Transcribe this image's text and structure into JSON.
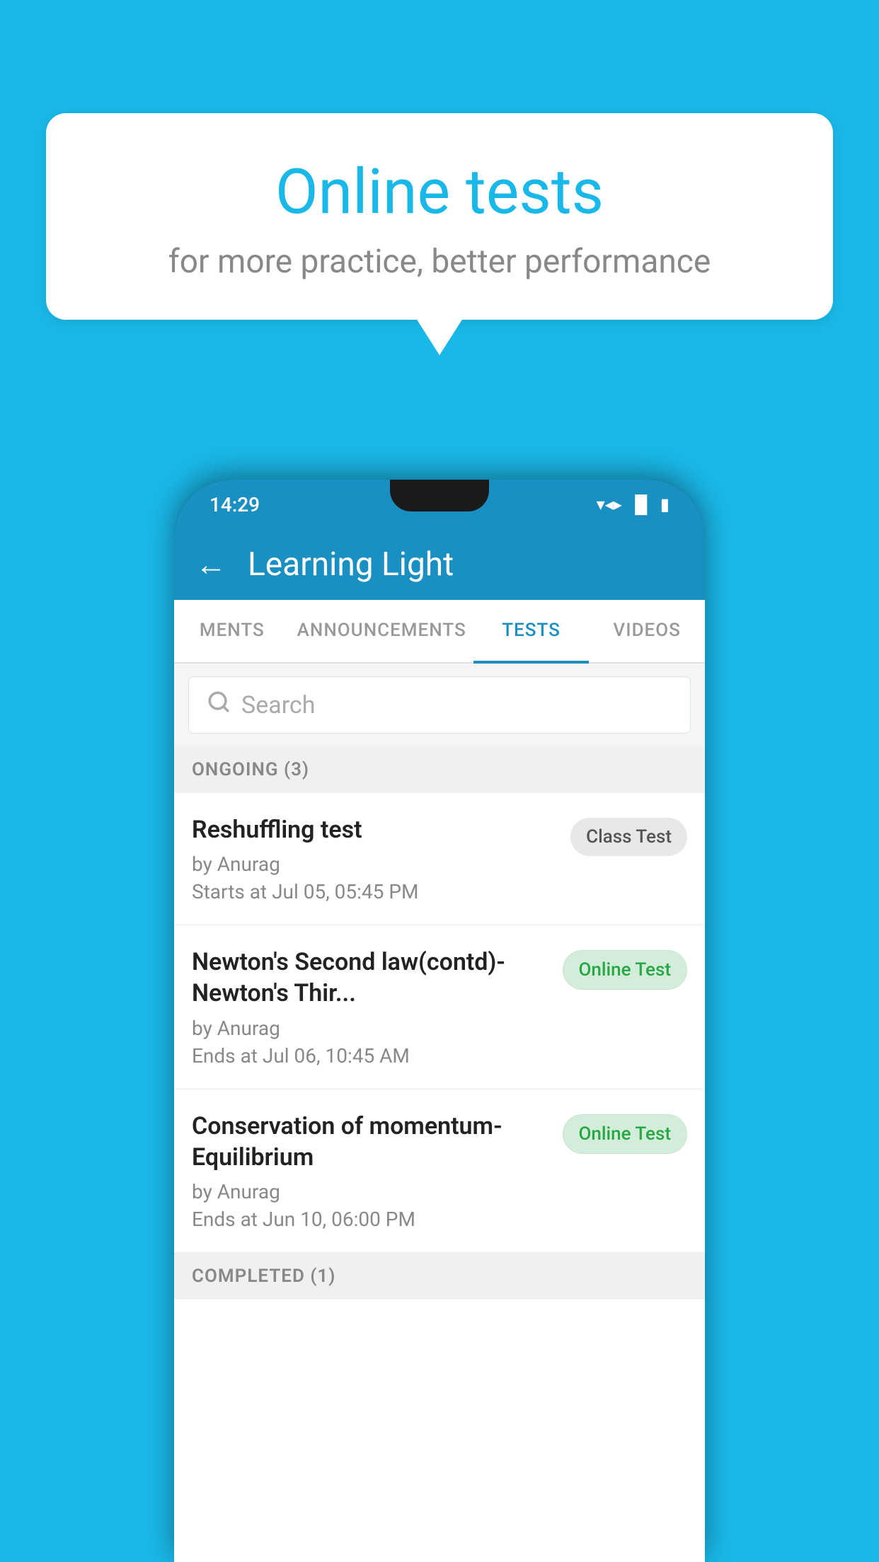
{
  "background_color": "#1ab8e8",
  "speech_bubble": {
    "title": "Online tests",
    "subtitle": "for more practice, better performance"
  },
  "phone": {
    "status_bar": {
      "time": "14:29",
      "icons": [
        "wifi",
        "signal",
        "battery"
      ]
    },
    "header": {
      "back_label": "←",
      "title": "Learning Light"
    },
    "tabs": [
      {
        "label": "MENTS",
        "active": false
      },
      {
        "label": "ANNOUNCEMENTS",
        "active": false
      },
      {
        "label": "TESTS",
        "active": true
      },
      {
        "label": "VIDEOS",
        "active": false
      }
    ],
    "search": {
      "placeholder": "Search"
    },
    "ongoing_section": {
      "label": "ONGOING (3)"
    },
    "test_items": [
      {
        "title": "Reshuffling test",
        "author": "by Anurag",
        "date": "Starts at  Jul 05, 05:45 PM",
        "badge": "Class Test",
        "badge_type": "class"
      },
      {
        "title": "Newton's Second law(contd)-Newton's Thir...",
        "author": "by Anurag",
        "date": "Ends at  Jul 06, 10:45 AM",
        "badge": "Online Test",
        "badge_type": "online"
      },
      {
        "title": "Conservation of momentum-Equilibrium",
        "author": "by Anurag",
        "date": "Ends at  Jun 10, 06:00 PM",
        "badge": "Online Test",
        "badge_type": "online"
      }
    ],
    "completed_section": {
      "label": "COMPLETED (1)"
    }
  }
}
